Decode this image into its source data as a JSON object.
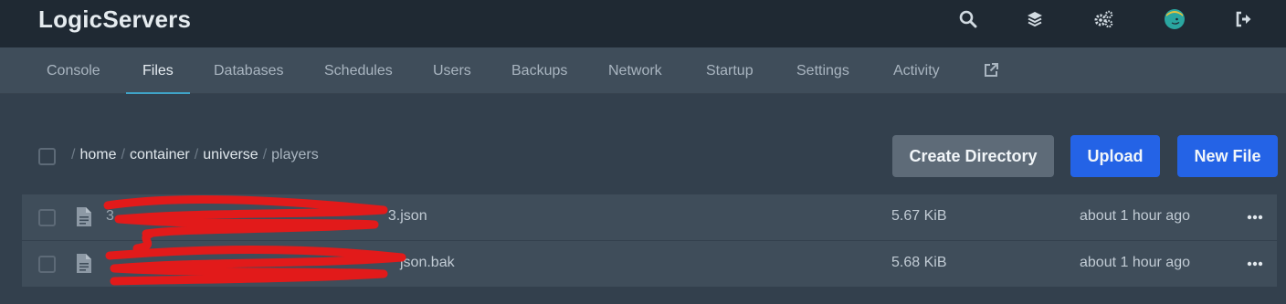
{
  "app": {
    "brand": "LogicServers"
  },
  "topbar": {
    "icons": [
      "search-icon",
      "layers-icon",
      "cogs-icon",
      "avatar-icon",
      "sign-out-icon"
    ],
    "accent": "#3fa3c7"
  },
  "nav": {
    "tabs": [
      {
        "label": "Console",
        "active": false
      },
      {
        "label": "Files",
        "active": true
      },
      {
        "label": "Databases",
        "active": false
      },
      {
        "label": "Schedules",
        "active": false
      },
      {
        "label": "Users",
        "active": false
      },
      {
        "label": "Backups",
        "active": false
      },
      {
        "label": "Network",
        "active": false
      },
      {
        "label": "Startup",
        "active": false
      },
      {
        "label": "Settings",
        "active": false
      },
      {
        "label": "Activity",
        "active": false
      }
    ],
    "external_icon": "external-link-icon"
  },
  "breadcrumb": {
    "separator": "/",
    "segments": [
      "home",
      "container",
      "universe",
      "players"
    ]
  },
  "actions": {
    "create_directory": "Create Directory",
    "upload": "Upload",
    "new_file": "New File",
    "colors": {
      "secondary": "#5e6b78",
      "primary": "#2463e6"
    }
  },
  "files": [
    {
      "name_visible": "3...93.json",
      "size": "5.67 KiB",
      "modified": "about 1 hour ago",
      "redacted": true
    },
    {
      "name_visible": "...json.bak",
      "size": "5.68 KiB",
      "modified": "about 1 hour ago",
      "redacted": true
    }
  ],
  "file_name_tail": [
    "3.json",
    "json.bak"
  ]
}
